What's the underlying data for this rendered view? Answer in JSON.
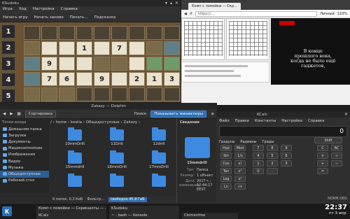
{
  "ksudoku": {
    "title": "KSudoku",
    "menu": [
      "Игра",
      "Ход",
      "Настройка",
      "Справка"
    ],
    "toolbar": [
      "Начать игру",
      "Начать заново",
      "Печать...",
      "Подсказка"
    ],
    "side_numbers": [
      "1",
      "2",
      "3",
      "4",
      "5"
    ],
    "grid": [
      [
        "",
        "",
        "",
        "",
        "",
        "",
        "",
        "",
        ""
      ],
      [
        "",
        "",
        "",
        "1",
        "",
        "7",
        "",
        "",
        ""
      ],
      [
        "",
        "9",
        "",
        "",
        "",
        "",
        "",
        "",
        ""
      ],
      [
        "",
        "7",
        "6",
        "",
        "9",
        "",
        "2",
        "1",
        "3"
      ],
      [
        "",
        "",
        "",
        "",
        "",
        "",
        "",
        "",
        ""
      ]
    ]
  },
  "firefox": {
    "title": "Комп с помойки — Скриншоты — Грамота - Mozilla Firefox",
    "tab_label": "Комп с помойки — Скр...",
    "url": "https://...",
    "url_right": "Личный",
    "zoom": "110%",
    "video_text": "В конце\nпрошлого века,\nкогда не было ещё\nгаджетов,"
  },
  "dolphin": {
    "title": "Zakazy — Dolphin",
    "toolbar": {
      "sort": "Сортировка",
      "search": "Поиск",
      "preview": "Показывать миниатюры"
    },
    "places_header": "Точки входа",
    "places": [
      "Домашняя папка",
      "Загрузки",
      "Документы",
      "Машинostreetние",
      "Изображения",
      "Видео",
      "Музыка",
      "Общедоступные",
      "Рабочий стол"
    ],
    "breadcrumb": "/ › home › kostia › Общедоступные › Zakazy ›",
    "folders": [
      "10mmDrill",
      "11Drill",
      "12drill",
      "15mmdrill",
      "16mmDrill",
      "17mmDrill",
      "",
      "",
      ""
    ],
    "status": "9 папок, 0,3 КиБ",
    "filter": "Фильтр...",
    "free": "свободно 45,8 ГиБ",
    "info": {
      "header": "Сведения",
      "name": "15mmdrill",
      "type_k": "Тип:",
      "type_v": "Папка",
      "size_k": "Размер:",
      "size_v": "1 объект",
      "mod_k": "Дата изменения:",
      "mod_v": "2017 г.; 12:44:17 EEST"
    }
  },
  "kcalc": {
    "title": "KCalc",
    "menu": [
      "Файл",
      "Правка",
      "Константы",
      "Настройка",
      "Справка"
    ],
    "display": "0",
    "radios": [
      "Градусы",
      "Радианы",
      "Грады"
    ],
    "buttons_left": [
      "Hyp",
      "Sin",
      "Cos",
      "Tan",
      "Log",
      "Ln"
    ],
    "buttons_mid": [
      "Mod",
      "1/x",
      "x!",
      "x²",
      "xʸ",
      "√x"
    ],
    "digits": [
      "7",
      "8",
      "9",
      "4",
      "5",
      "6",
      "1",
      "2",
      "3",
      "0",
      "."
    ],
    "ops": [
      "C",
      "AC",
      "×",
      "÷",
      "+",
      "−",
      "="
    ],
    "mode": [
      "NORM",
      "DEG"
    ],
    "shift": "Shift"
  },
  "taskbar": {
    "tasks": [
      "Комп с помойки — Скриншоты — ...",
      "KSudoku",
      "KCalc",
      "~ : bash — Konsole",
      "Clementine"
    ],
    "time": "22:37",
    "date": "пт 3 апр."
  }
}
